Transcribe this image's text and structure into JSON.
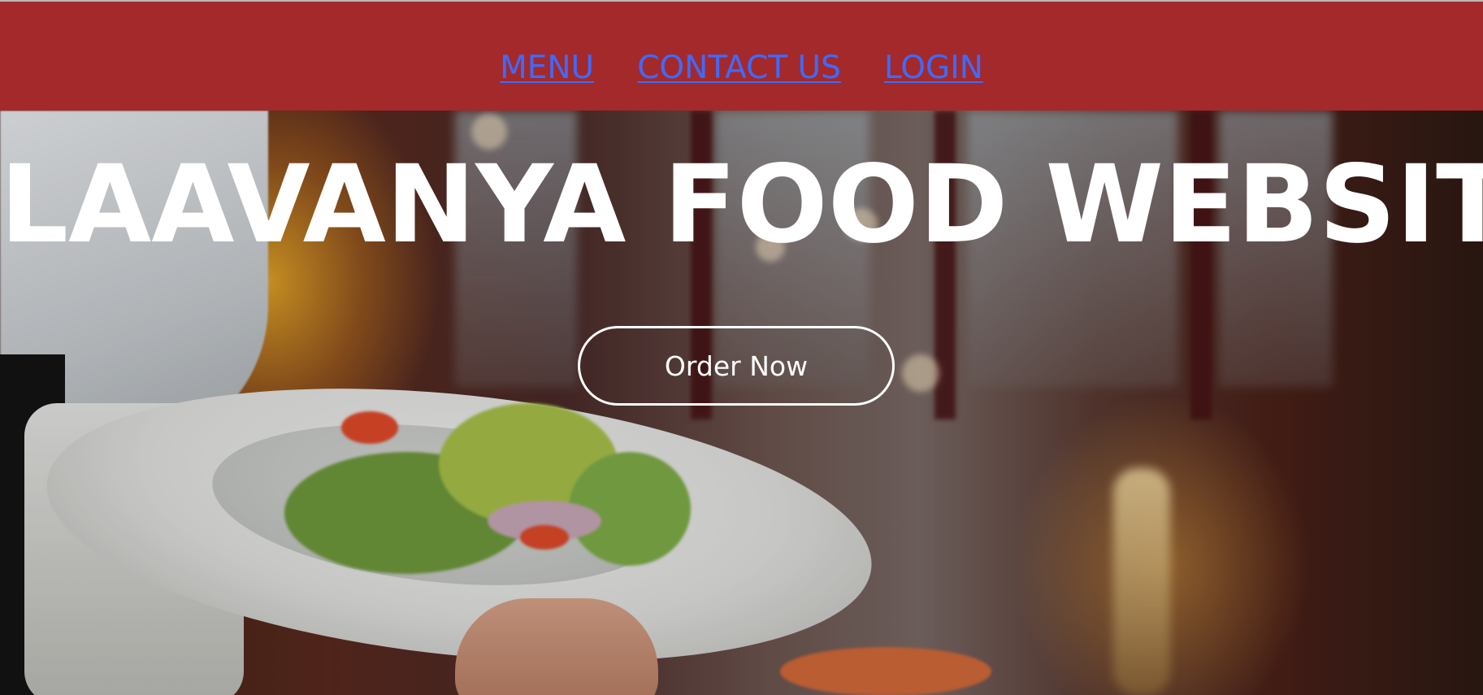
{
  "nav": {
    "items": [
      {
        "label": "MENU"
      },
      {
        "label": "CONTACT US"
      },
      {
        "label": "LOGIN"
      }
    ]
  },
  "hero": {
    "title": "LAAVANYA FOOD WEBSITE",
    "button_label": "Order Now",
    "background_image": "restaurant-waiter-salad-photo"
  },
  "colors": {
    "header_bg": "#a4292b",
    "nav_link": "#3d6bff",
    "title_text": "#ffffff"
  }
}
